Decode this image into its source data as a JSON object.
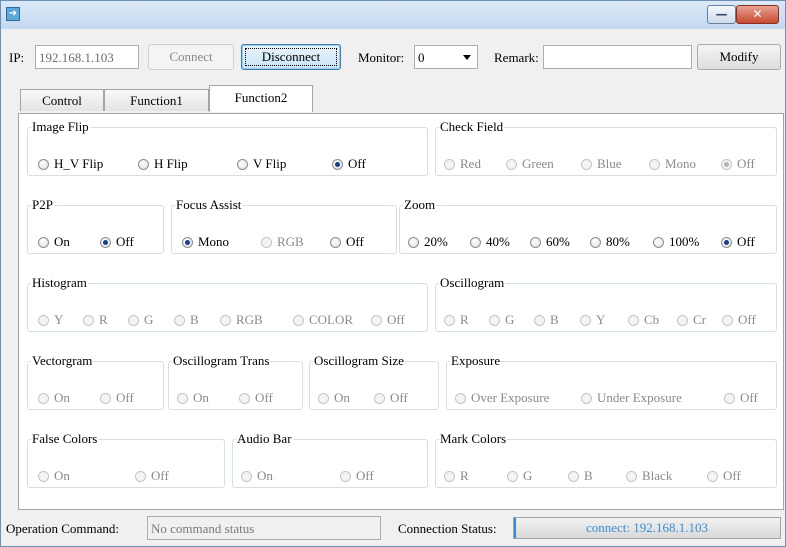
{
  "window": {
    "minimize_glyph": "—",
    "close_glyph": "✕",
    "icon_glyph": "➜"
  },
  "toolbar": {
    "ip_label": "IP:",
    "ip_value": "192.168.1.103",
    "connect_label": "Connect",
    "disconnect_label": "Disconnect",
    "monitor_label": "Monitor:",
    "monitor_value": "0",
    "remark_label": "Remark:",
    "remark_value": "",
    "modify_label": "Modify"
  },
  "tabs": [
    {
      "label": "Control",
      "active": false
    },
    {
      "label": "Function1",
      "active": false
    },
    {
      "label": "Function2",
      "active": true
    }
  ],
  "groups": {
    "image_flip": {
      "title": "Image Flip",
      "options": [
        "H_V Flip",
        "H Flip",
        "V Flip",
        "Off"
      ],
      "selected": "Off",
      "enabled": true
    },
    "check_field": {
      "title": "Check Field",
      "options": [
        "Red",
        "Green",
        "Blue",
        "Mono",
        "Off"
      ],
      "selected": "Off",
      "enabled": false
    },
    "p2p": {
      "title": "P2P",
      "options": [
        "On",
        "Off"
      ],
      "selected": "Off",
      "enabled": true
    },
    "focus_assist": {
      "title": "Focus Assist",
      "options": [
        "Mono",
        "RGB",
        "Off"
      ],
      "selected": "Mono",
      "enabled": true,
      "disabled_options": [
        "RGB"
      ]
    },
    "zoom": {
      "title": "Zoom",
      "options": [
        "20%",
        "40%",
        "60%",
        "80%",
        "100%",
        "Off"
      ],
      "selected": "Off",
      "enabled": true
    },
    "histogram": {
      "title": "Histogram",
      "options": [
        "Y",
        "R",
        "G",
        "B",
        "RGB",
        "COLOR",
        "Off"
      ],
      "selected": "",
      "enabled": false
    },
    "oscillogram": {
      "title": "Oscillogram",
      "options": [
        "R",
        "G",
        "B",
        "Y",
        "Cb",
        "Cr",
        "Off"
      ],
      "selected": "",
      "enabled": false
    },
    "vectorgram": {
      "title": "Vectorgram",
      "options": [
        "On",
        "Off"
      ],
      "selected": "",
      "enabled": false
    },
    "oscillogram_trans": {
      "title": "Oscillogram Trans",
      "options": [
        "On",
        "Off"
      ],
      "selected": "",
      "enabled": false
    },
    "oscillogram_size": {
      "title": "Oscillogram Size",
      "options": [
        "On",
        "Off"
      ],
      "selected": "",
      "enabled": false
    },
    "exposure": {
      "title": "Exposure",
      "options": [
        "Over Exposure",
        "Under Exposure",
        "Off"
      ],
      "selected": "",
      "enabled": false
    },
    "false_colors": {
      "title": "False Colors",
      "options": [
        "On",
        "Off"
      ],
      "selected": "",
      "enabled": false
    },
    "audio_bar": {
      "title": "Audio Bar",
      "options": [
        "On",
        "Off"
      ],
      "selected": "",
      "enabled": false
    },
    "mark_colors": {
      "title": "Mark Colors",
      "options": [
        "R",
        "G",
        "B",
        "Black",
        "Off"
      ],
      "selected": "",
      "enabled": false
    }
  },
  "statusbar": {
    "operation_label": "Operation Command:",
    "operation_value": "No command status",
    "connection_label": "Connection Status:",
    "connection_value": "connect: 192.168.1.103"
  },
  "colors": {
    "accent": "#3b8fd6",
    "selected_dot": "#1a3f8b",
    "disabled_text": "#8a8a8a"
  }
}
